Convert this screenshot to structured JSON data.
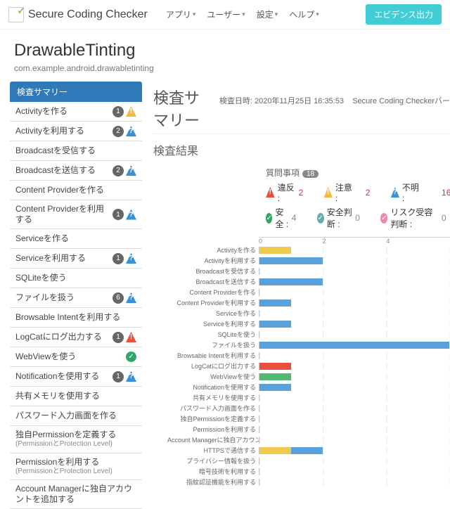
{
  "brand": "Secure Coding Checker",
  "topnav": [
    "アプリ",
    "ユーザー",
    "設定",
    "ヘルプ"
  ],
  "export_btn": "エビデンス出力",
  "project": {
    "name": "DrawableTinting",
    "package": "com.example.android.drawabletinting"
  },
  "sidebar_header": "検査サマリー",
  "sidebar": [
    {
      "label": "Activityを作る",
      "count": 1,
      "icons": [
        "caution"
      ]
    },
    {
      "label": "Activityを利用する",
      "count": 2,
      "icons": [
        "unk"
      ]
    },
    {
      "label": "Broadcastを受信する",
      "count": null,
      "icons": []
    },
    {
      "label": "Broadcastを送信する",
      "count": 2,
      "icons": [
        "unk"
      ]
    },
    {
      "label": "Content Providerを作る",
      "count": null,
      "icons": []
    },
    {
      "label": "Content Providerを利用する",
      "count": 1,
      "icons": [
        "unk"
      ]
    },
    {
      "label": "Serviceを作る",
      "count": null,
      "icons": []
    },
    {
      "label": "Serviceを利用する",
      "count": 1,
      "icons": [
        "unk"
      ]
    },
    {
      "label": "SQLiteを使う",
      "count": null,
      "icons": []
    },
    {
      "label": "ファイルを扱う",
      "count": 6,
      "icons": [
        "unk"
      ]
    },
    {
      "label": "Browsable Intentを利用する",
      "count": null,
      "icons": []
    },
    {
      "label": "LogCatにログ出力する",
      "count": 1,
      "icons": [
        "warn"
      ]
    },
    {
      "label": "WebViewを使う",
      "count": null,
      "icons": [
        "safe"
      ]
    },
    {
      "label": "Notificationを使用する",
      "count": 1,
      "icons": [
        "unk"
      ]
    },
    {
      "label": "共有メモリを使用する",
      "count": null,
      "icons": []
    },
    {
      "label": "パスワード入力画面を作る",
      "count": null,
      "icons": []
    },
    {
      "label": "独自Permissionを定義する",
      "sub": "(PermissionとProtection Level)",
      "count": null,
      "icons": []
    },
    {
      "label": "Permissionを利用する",
      "sub": "(PermissionとProtection Level)",
      "count": null,
      "icons": []
    },
    {
      "label": "Account Managerに独自アカウントを追加する",
      "count": null,
      "icons": []
    }
  ],
  "main": {
    "title": "検査サマリー",
    "datetime_label": "検査日時:",
    "datetime": "2020年11月25日 16:35:53",
    "version_label": "Secure Coding Checkerバー",
    "result_heading": "検査結果",
    "q_label": "質問事項",
    "q_count": 18,
    "stats": {
      "violation": {
        "label": "違反 :",
        "value": 2
      },
      "caution": {
        "label": "注意 :",
        "value": 2
      },
      "unknown": {
        "label": "不明 :",
        "value": 16
      },
      "safe": {
        "label": "安全 :",
        "value": 4
      },
      "safedec": {
        "label": "安全判断 :",
        "value": 0
      },
      "risk": {
        "label": "リスク受容判断 :",
        "value": 0
      }
    }
  },
  "chart_data": {
    "type": "bar",
    "xlim": [
      0,
      6
    ],
    "ticks": [
      0,
      2,
      4
    ],
    "unit_pct": 16.6,
    "rows": [
      {
        "label": "Activityを作る",
        "c": 1
      },
      {
        "label": "Activityを利用する",
        "u": 2
      },
      {
        "label": "Broadcastを受信する"
      },
      {
        "label": "Broadcastを送信する",
        "u": 2
      },
      {
        "label": "Content Providerを作る"
      },
      {
        "label": "Content Providerを利用する",
        "u": 1
      },
      {
        "label": "Serviceを作る"
      },
      {
        "label": "Serviceを利用する",
        "u": 1
      },
      {
        "label": "SQLiteを使う"
      },
      {
        "label": "ファイルを扱う",
        "u": 6
      },
      {
        "label": "Browsable Intentを利用する"
      },
      {
        "label": "LogCatにログ出力する",
        "v": 1
      },
      {
        "label": "WebViewを使う",
        "s": 1
      },
      {
        "label": "Notificationを使用する",
        "u": 1
      },
      {
        "label": "共有メモリを使用する"
      },
      {
        "label": "パスワード入力画面を作る"
      },
      {
        "label": "独自Permissionを定義する"
      },
      {
        "label": "Permissionを利用する"
      },
      {
        "label": "Account Managerに独自アカウントを追加する"
      },
      {
        "label": "HTTPSで通信する",
        "c": 1,
        "u": 1
      },
      {
        "label": "プライバシー情報を扱う"
      },
      {
        "label": "暗号技術を利用する"
      },
      {
        "label": "指紋認証機能を利用する"
      }
    ]
  }
}
